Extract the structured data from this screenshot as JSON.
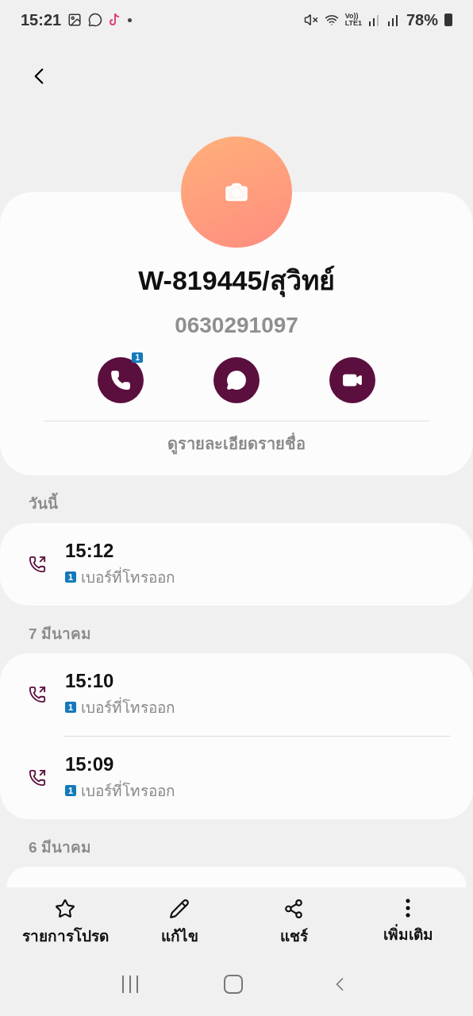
{
  "status_bar": {
    "time": "15:21",
    "network_top": "Vo))",
    "network_bottom": "LTE1",
    "battery": "78%"
  },
  "contact": {
    "name": "W-819445/สุวิทย์",
    "number": "0630291097",
    "details_link": "ดูรายละเอียดรายชื่อ"
  },
  "actions": [
    {
      "kind": "call",
      "badge": "1"
    },
    {
      "kind": "message"
    },
    {
      "kind": "video"
    }
  ],
  "sections": [
    {
      "date": "วันนี้",
      "calls": [
        {
          "kind": "outgoing",
          "time": "15:12",
          "sim": "1",
          "label": "เบอร์ที่โทรออก"
        }
      ]
    },
    {
      "date": "7 มีนาคม",
      "calls": [
        {
          "kind": "outgoing",
          "time": "15:10",
          "sim": "1",
          "label": "เบอร์ที่โทรออก"
        },
        {
          "kind": "outgoing",
          "time": "15:09",
          "sim": "1",
          "label": "เบอร์ที่โทรออก"
        }
      ]
    },
    {
      "date": "6 มีนาคม"
    }
  ],
  "bottom_bar": [
    {
      "kind": "star",
      "label": "รายการโปรด"
    },
    {
      "kind": "edit",
      "label": "แก้ไข"
    },
    {
      "kind": "share",
      "label": "แชร์"
    },
    {
      "kind": "more",
      "label": "เพิ่มเติม"
    }
  ]
}
